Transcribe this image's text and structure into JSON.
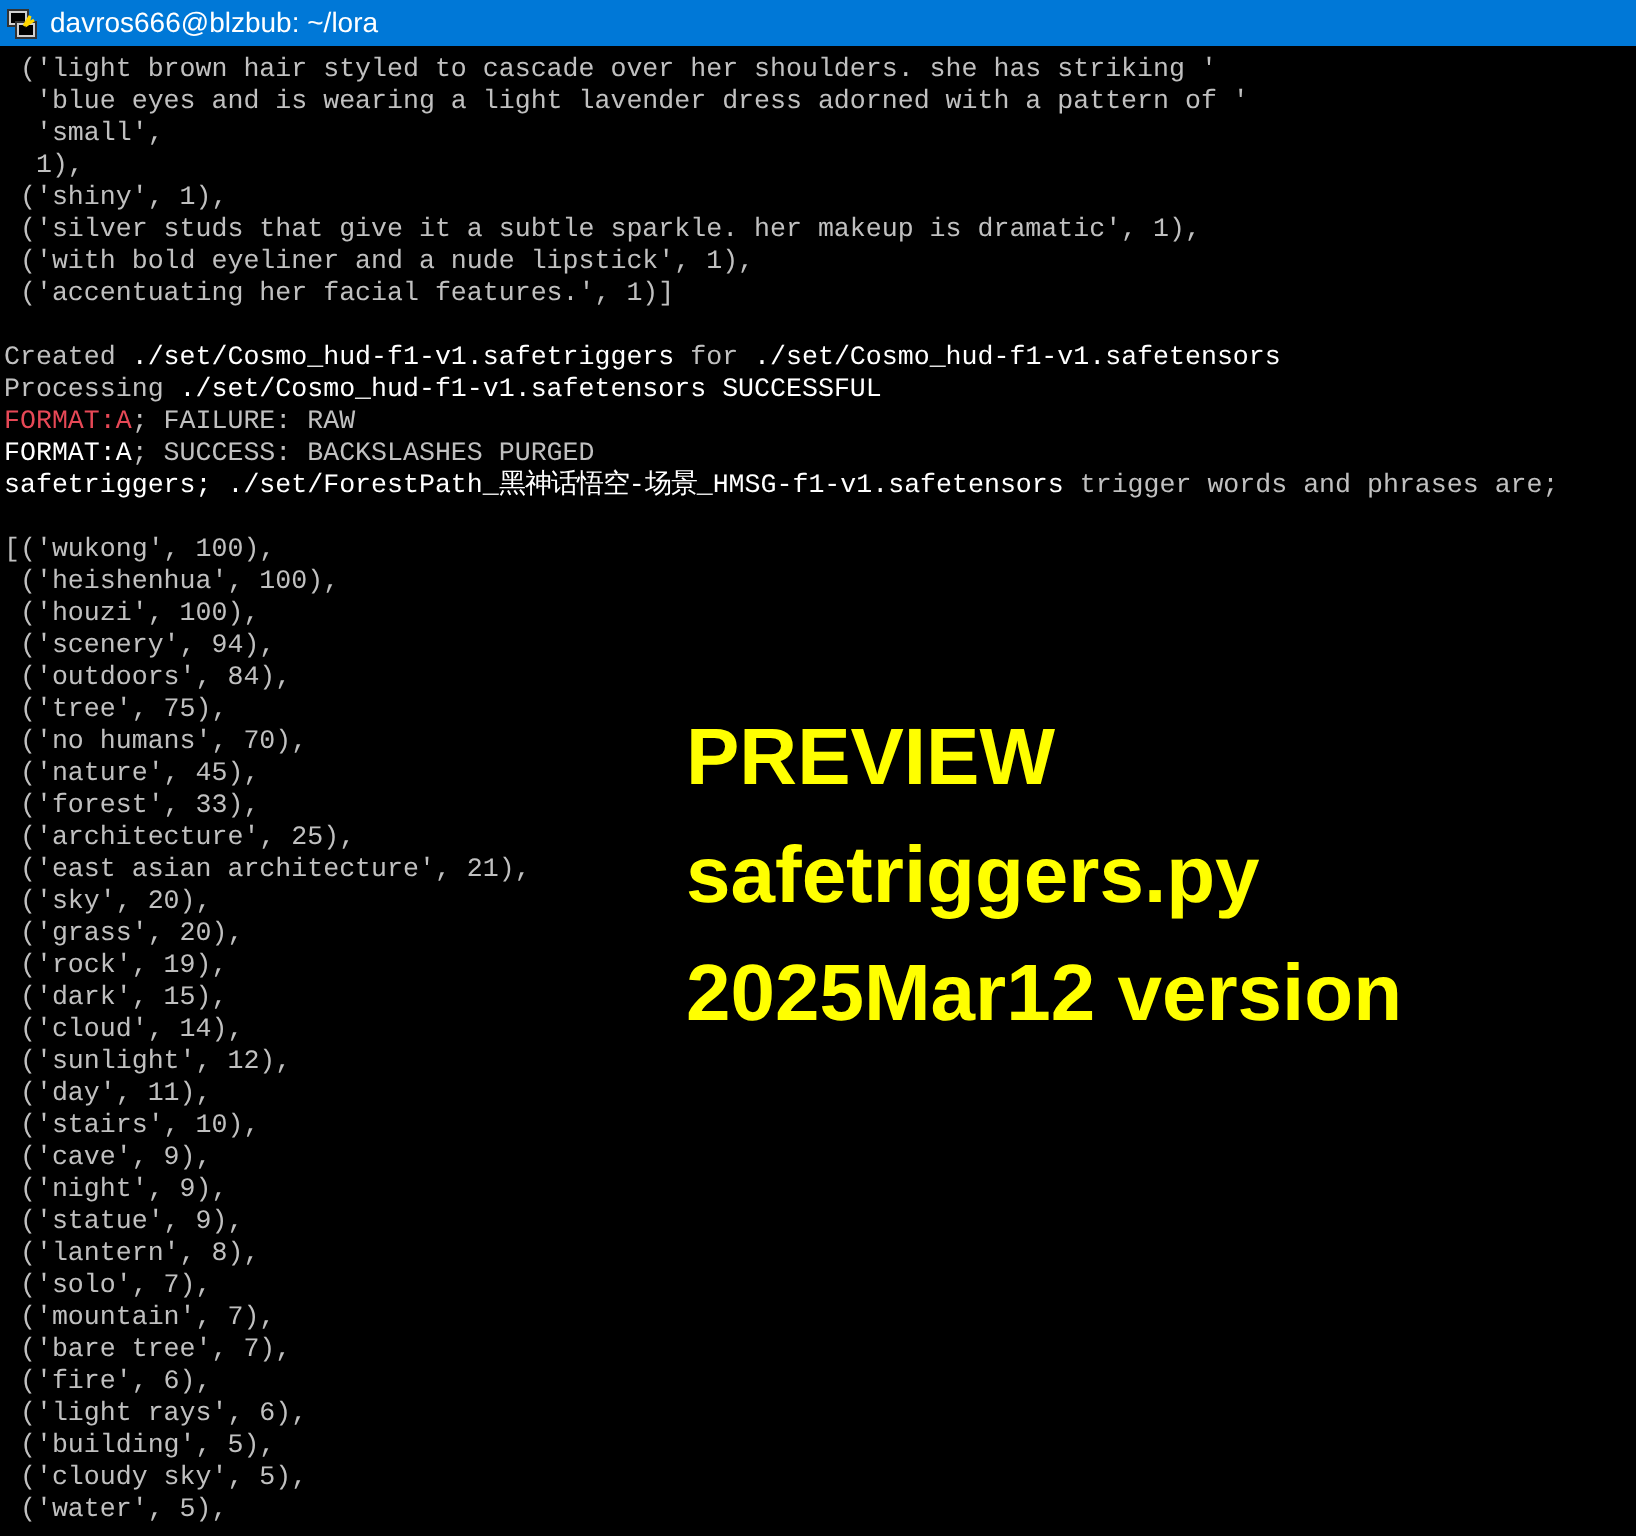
{
  "window": {
    "title": "davros666@blzbub: ~/lora"
  },
  "terminal": {
    "lines": [
      {
        "kind": "text",
        "segments": [
          {
            "text": " ('light brown hair styled to cascade over her shoulders. she has striking '",
            "kind": "normal"
          }
        ]
      },
      {
        "kind": "text",
        "segments": [
          {
            "text": "  'blue eyes and is wearing a light lavender dress adorned with a pattern of '",
            "kind": "normal"
          }
        ]
      },
      {
        "kind": "text",
        "segments": [
          {
            "text": "  'small',",
            "kind": "normal"
          }
        ]
      },
      {
        "kind": "text",
        "segments": [
          {
            "text": "  1),",
            "kind": "normal"
          }
        ]
      },
      {
        "kind": "text",
        "segments": [
          {
            "text": " ('shiny', 1),",
            "kind": "normal"
          }
        ]
      },
      {
        "kind": "text",
        "segments": [
          {
            "text": " ('silver studs that give it a subtle sparkle. her makeup is dramatic', 1),",
            "kind": "normal"
          }
        ]
      },
      {
        "kind": "text",
        "segments": [
          {
            "text": " ('with bold eyeliner and a nude lipstick', 1),",
            "kind": "normal"
          }
        ]
      },
      {
        "kind": "text",
        "segments": [
          {
            "text": " ('accentuating her facial features.', 1)]",
            "kind": "normal"
          }
        ]
      },
      {
        "kind": "blank"
      },
      {
        "kind": "text",
        "segments": [
          {
            "text": "Created ",
            "kind": "normal"
          },
          {
            "text": "./set/Cosmo_hud-f1-v1.safetriggers ",
            "kind": "bright"
          },
          {
            "text": "for ",
            "kind": "normal"
          },
          {
            "text": "./set/Cosmo_hud-f1-v1.safetensors",
            "kind": "bright"
          }
        ]
      },
      {
        "kind": "text",
        "segments": [
          {
            "text": "Processing ",
            "kind": "normal"
          },
          {
            "text": "./set/Cosmo_hud-f1-v1.safetensors SUCCESSFUL",
            "kind": "bright"
          }
        ]
      },
      {
        "kind": "text",
        "segments": [
          {
            "text": "FORMAT:A",
            "kind": "error"
          },
          {
            "text": "; FAILURE: RAW",
            "kind": "normal"
          }
        ]
      },
      {
        "kind": "text",
        "segments": [
          {
            "text": "FORMAT:A",
            "kind": "bright"
          },
          {
            "text": "; SUCCESS: BACKSLASHES PURGED",
            "kind": "normal"
          }
        ]
      },
      {
        "kind": "text",
        "segments": [
          {
            "text": "safetriggers; ./set/ForestPath_黑神话悟空-场景_HMSG-f1-v1.safetensors ",
            "kind": "bright"
          },
          {
            "text": "trigger words and phrases are;",
            "kind": "normal"
          }
        ]
      },
      {
        "kind": "blank"
      },
      {
        "kind": "text",
        "segments": [
          {
            "text": "[('wukong', 100),",
            "kind": "normal"
          }
        ]
      },
      {
        "kind": "text",
        "segments": [
          {
            "text": " ('heishenhua', 100),",
            "kind": "normal"
          }
        ]
      },
      {
        "kind": "text",
        "segments": [
          {
            "text": " ('houzi', 100),",
            "kind": "normal"
          }
        ]
      },
      {
        "kind": "text",
        "segments": [
          {
            "text": " ('scenery', 94),",
            "kind": "normal"
          }
        ]
      },
      {
        "kind": "text",
        "segments": [
          {
            "text": " ('outdoors', 84),",
            "kind": "normal"
          }
        ]
      },
      {
        "kind": "text",
        "segments": [
          {
            "text": " ('tree', 75),",
            "kind": "normal"
          }
        ]
      },
      {
        "kind": "text",
        "segments": [
          {
            "text": " ('no humans', 70),",
            "kind": "normal"
          }
        ]
      },
      {
        "kind": "text",
        "segments": [
          {
            "text": " ('nature', 45),",
            "kind": "normal"
          }
        ]
      },
      {
        "kind": "text",
        "segments": [
          {
            "text": " ('forest', 33),",
            "kind": "normal"
          }
        ]
      },
      {
        "kind": "text",
        "segments": [
          {
            "text": " ('architecture', 25),",
            "kind": "normal"
          }
        ]
      },
      {
        "kind": "text",
        "segments": [
          {
            "text": " ('east asian architecture', 21),",
            "kind": "normal"
          }
        ]
      },
      {
        "kind": "text",
        "segments": [
          {
            "text": " ('sky', 20),",
            "kind": "normal"
          }
        ]
      },
      {
        "kind": "text",
        "segments": [
          {
            "text": " ('grass', 20),",
            "kind": "normal"
          }
        ]
      },
      {
        "kind": "text",
        "segments": [
          {
            "text": " ('rock', 19),",
            "kind": "normal"
          }
        ]
      },
      {
        "kind": "text",
        "segments": [
          {
            "text": " ('dark', 15),",
            "kind": "normal"
          }
        ]
      },
      {
        "kind": "text",
        "segments": [
          {
            "text": " ('cloud', 14),",
            "kind": "normal"
          }
        ]
      },
      {
        "kind": "text",
        "segments": [
          {
            "text": " ('sunlight', 12),",
            "kind": "normal"
          }
        ]
      },
      {
        "kind": "text",
        "segments": [
          {
            "text": " ('day', 11),",
            "kind": "normal"
          }
        ]
      },
      {
        "kind": "text",
        "segments": [
          {
            "text": " ('stairs', 10),",
            "kind": "normal"
          }
        ]
      },
      {
        "kind": "text",
        "segments": [
          {
            "text": " ('cave', 9),",
            "kind": "normal"
          }
        ]
      },
      {
        "kind": "text",
        "segments": [
          {
            "text": " ('night', 9),",
            "kind": "normal"
          }
        ]
      },
      {
        "kind": "text",
        "segments": [
          {
            "text": " ('statue', 9),",
            "kind": "normal"
          }
        ]
      },
      {
        "kind": "text",
        "segments": [
          {
            "text": " ('lantern', 8),",
            "kind": "normal"
          }
        ]
      },
      {
        "kind": "text",
        "segments": [
          {
            "text": " ('solo', 7),",
            "kind": "normal"
          }
        ]
      },
      {
        "kind": "text",
        "segments": [
          {
            "text": " ('mountain', 7),",
            "kind": "normal"
          }
        ]
      },
      {
        "kind": "text",
        "segments": [
          {
            "text": " ('bare tree', 7),",
            "kind": "normal"
          }
        ]
      },
      {
        "kind": "text",
        "segments": [
          {
            "text": " ('fire', 6),",
            "kind": "normal"
          }
        ]
      },
      {
        "kind": "text",
        "segments": [
          {
            "text": " ('light rays', 6),",
            "kind": "normal"
          }
        ]
      },
      {
        "kind": "text",
        "segments": [
          {
            "text": " ('building', 5),",
            "kind": "normal"
          }
        ]
      },
      {
        "kind": "text",
        "segments": [
          {
            "text": " ('cloudy sky', 5),",
            "kind": "normal"
          }
        ]
      },
      {
        "kind": "text",
        "segments": [
          {
            "text": " ('water', 5),",
            "kind": "normal"
          }
        ]
      }
    ]
  },
  "overlay": {
    "lines": [
      "PREVIEW",
      "safetriggers.py",
      "2025Mar12 version"
    ]
  }
}
